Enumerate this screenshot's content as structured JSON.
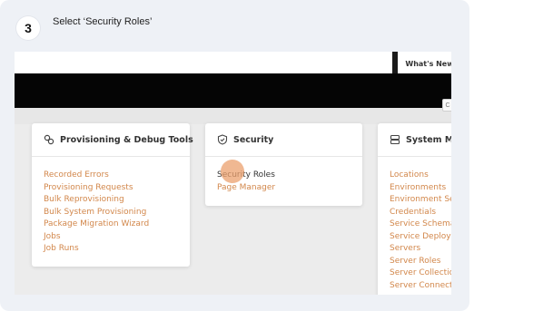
{
  "step": {
    "number": "3",
    "instruction": "Select ‘Security Roles’"
  },
  "header": {
    "whats_new_label": "What's New",
    "corner_label": "C"
  },
  "panels": [
    {
      "title": "Provisioning & Debug Tools",
      "icon": "link-icon",
      "links": [
        "Recorded Errors",
        "Provisioning Requests",
        "Bulk Reprovisioning",
        "Bulk System Provisioning",
        "Package Migration Wizard",
        "Jobs",
        "Job Runs"
      ]
    },
    {
      "title": "Security",
      "icon": "shield-icon",
      "links": [
        "Security Roles",
        "Page Manager"
      ]
    },
    {
      "title": "System Mar",
      "icon": "server-icon",
      "links": [
        "Locations",
        "Environments",
        "Environment Se",
        "Credentials",
        "Service Schema",
        "Service Deploym",
        "Servers",
        "Server Roles",
        "Server Collection",
        "Server Connecti"
      ]
    }
  ],
  "colors": {
    "link": "#d2874b",
    "highlight": "#eba06e",
    "card_background": "#eef1f6"
  }
}
